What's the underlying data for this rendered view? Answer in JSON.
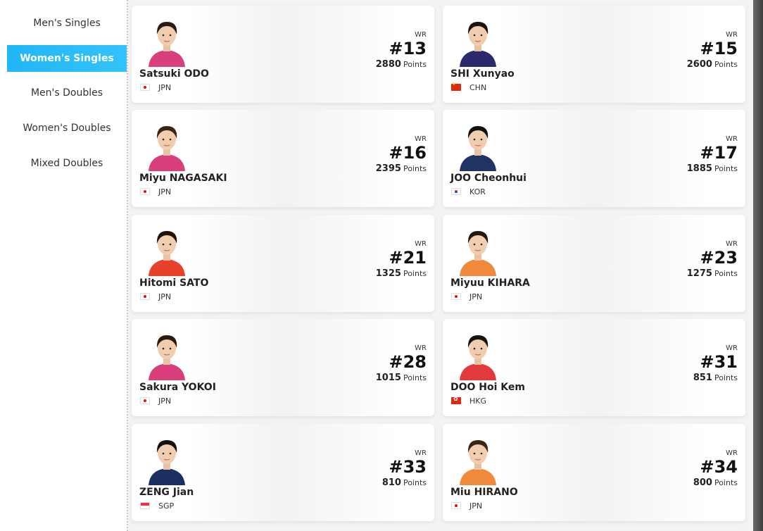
{
  "sidebar": {
    "items": [
      {
        "label": "Men's Singles",
        "active": false
      },
      {
        "label": "Women's Singles",
        "active": true
      },
      {
        "label": "Men's Doubles",
        "active": false
      },
      {
        "label": "Women's Doubles",
        "active": false
      },
      {
        "label": "Mixed Doubles",
        "active": false
      }
    ]
  },
  "colors": {
    "accent": "#20b7f7"
  },
  "players": [
    {
      "name": "Satsuki ODO",
      "country": "JPN",
      "flag": "jpn",
      "wr_label": "WR",
      "rank": "#13",
      "points": "2880",
      "points_label": "Points",
      "shirt": "#d9407b",
      "hair": "#2a1a12"
    },
    {
      "name": "SHI Xunyao",
      "country": "CHN",
      "flag": "chn",
      "wr_label": "WR",
      "rank": "#15",
      "points": "2600",
      "points_label": "Points",
      "shirt": "#2b2a6e",
      "hair": "#1a120e"
    },
    {
      "name": "Miyu NAGASAKI",
      "country": "JPN",
      "flag": "jpn",
      "wr_label": "WR",
      "rank": "#16",
      "points": "2395",
      "points_label": "Points",
      "shirt": "#d9407b",
      "hair": "#3a2418"
    },
    {
      "name": "JOO Cheonhui",
      "country": "KOR",
      "flag": "kor",
      "wr_label": "WR",
      "rank": "#17",
      "points": "1885",
      "points_label": "Points",
      "shirt": "#1f3463",
      "hair": "#111"
    },
    {
      "name": "Hitomi SATO",
      "country": "JPN",
      "flag": "jpn",
      "wr_label": "WR",
      "rank": "#21",
      "points": "1325",
      "points_label": "Points",
      "shirt": "#e8412a",
      "hair": "#1c120c"
    },
    {
      "name": "Miyuu KIHARA",
      "country": "JPN",
      "flag": "jpn",
      "wr_label": "WR",
      "rank": "#23",
      "points": "1275",
      "points_label": "Points",
      "shirt": "#ef8a3c",
      "hair": "#241610"
    },
    {
      "name": "Sakura YOKOI",
      "country": "JPN",
      "flag": "jpn",
      "wr_label": "WR",
      "rank": "#28",
      "points": "1015",
      "points_label": "Points",
      "shirt": "#d9407b",
      "hair": "#2c1a10"
    },
    {
      "name": "DOO Hoi Kem",
      "country": "HKG",
      "flag": "hkg",
      "wr_label": "WR",
      "rank": "#31",
      "points": "851",
      "points_label": "Points",
      "shirt": "#e23a3a",
      "hair": "#1a120c"
    },
    {
      "name": "ZENG Jian",
      "country": "SGP",
      "flag": "sgp",
      "wr_label": "WR",
      "rank": "#33",
      "points": "810",
      "points_label": "Points",
      "shirt": "#1c2f63",
      "hair": "#111"
    },
    {
      "name": "Miu HIRANO",
      "country": "JPN",
      "flag": "jpn",
      "wr_label": "WR",
      "rank": "#34",
      "points": "800",
      "points_label": "Points",
      "shirt": "#ef8a3c",
      "hair": "#3a2414"
    }
  ]
}
